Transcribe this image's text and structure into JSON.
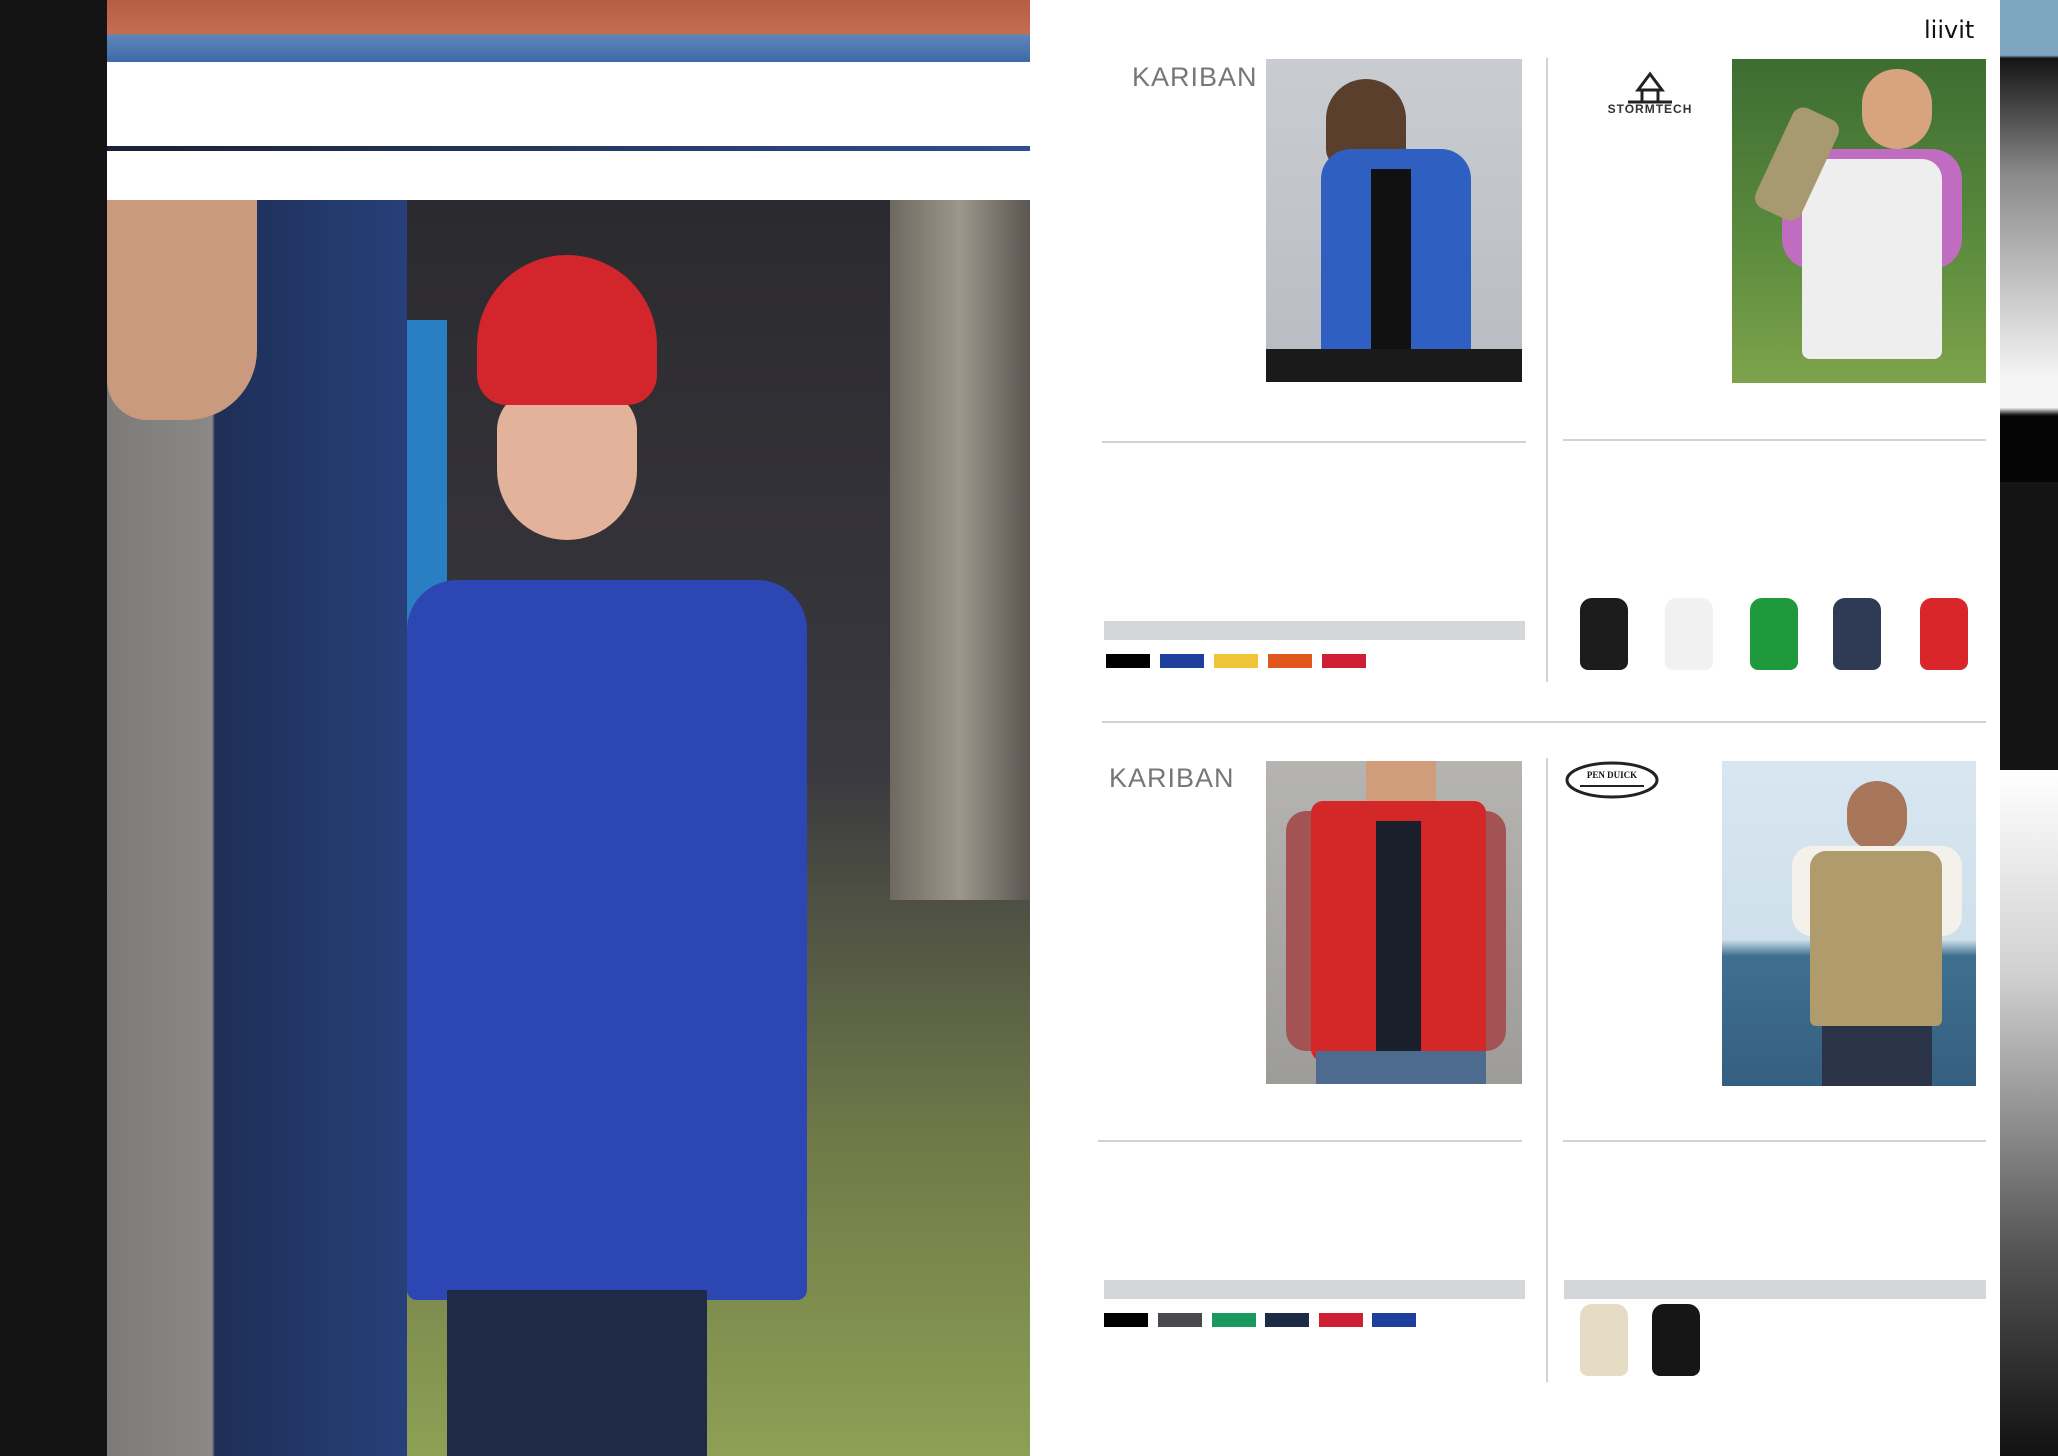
{
  "page": {
    "section_label": "liivit"
  },
  "products": [
    {
      "brand": "KARIBAN",
      "colors": [
        "#000000",
        "#1e3f9c",
        "#f0c53a",
        "#e0581d",
        "#cf1f34"
      ]
    },
    {
      "brand": "STORMTECH",
      "thumb_colors": [
        "#1c1c1c",
        "#f1f1f1",
        "#1e9a3c",
        "#2f3a55",
        "#d8262b"
      ]
    },
    {
      "brand": "KARIBAN",
      "colors": [
        "#000000",
        "#4a4a4e",
        "#1a9a5e",
        "#1c2c45",
        "#cf1f34",
        "#1e3f9c"
      ]
    },
    {
      "brand": "PEN DUICK",
      "thumb_colors": [
        "#e4dcc4",
        "#161616"
      ]
    }
  ],
  "colors": {
    "spine": "#141414",
    "divider": "#d0d4d8",
    "bar": "#d3d7da"
  }
}
